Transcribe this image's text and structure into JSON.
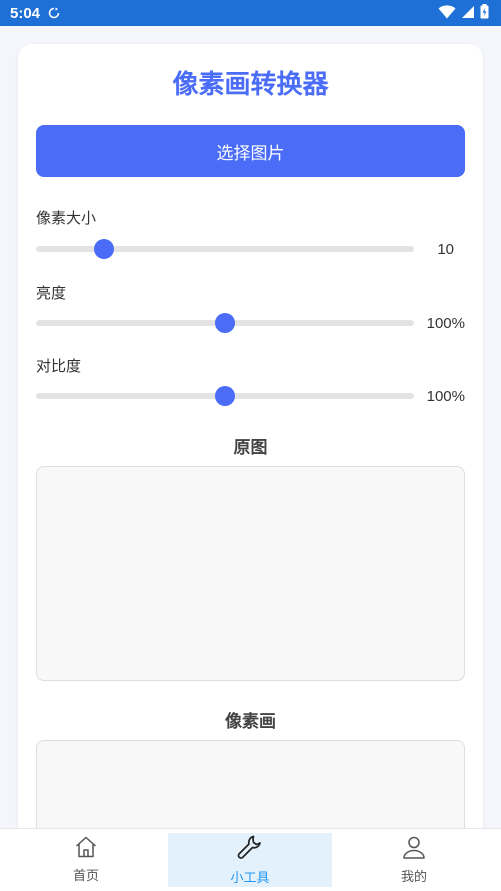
{
  "status_bar": {
    "time": "5:04"
  },
  "app": {
    "title": "像素画转换器",
    "select_button_label": "选择图片",
    "sliders": [
      {
        "label": "像素大小",
        "value_text": "10",
        "position": 0.18
      },
      {
        "label": "亮度",
        "value_text": "100%",
        "position": 0.5
      },
      {
        "label": "对比度",
        "value_text": "100%",
        "position": 0.5
      }
    ],
    "original_section": "原图",
    "pixel_section": "像素画"
  },
  "tabbar": {
    "items": [
      {
        "label": "首页",
        "icon": "home-icon",
        "active": false
      },
      {
        "label": "小工具",
        "icon": "wrench-icon",
        "active": true
      },
      {
        "label": "我的",
        "icon": "user-icon",
        "active": false
      }
    ]
  },
  "colors": {
    "accent": "#4a6cf7",
    "status_bar": "#1e6fd6",
    "tab_active": "#2196f3",
    "tab_active_bg": "#e3f1fc"
  }
}
